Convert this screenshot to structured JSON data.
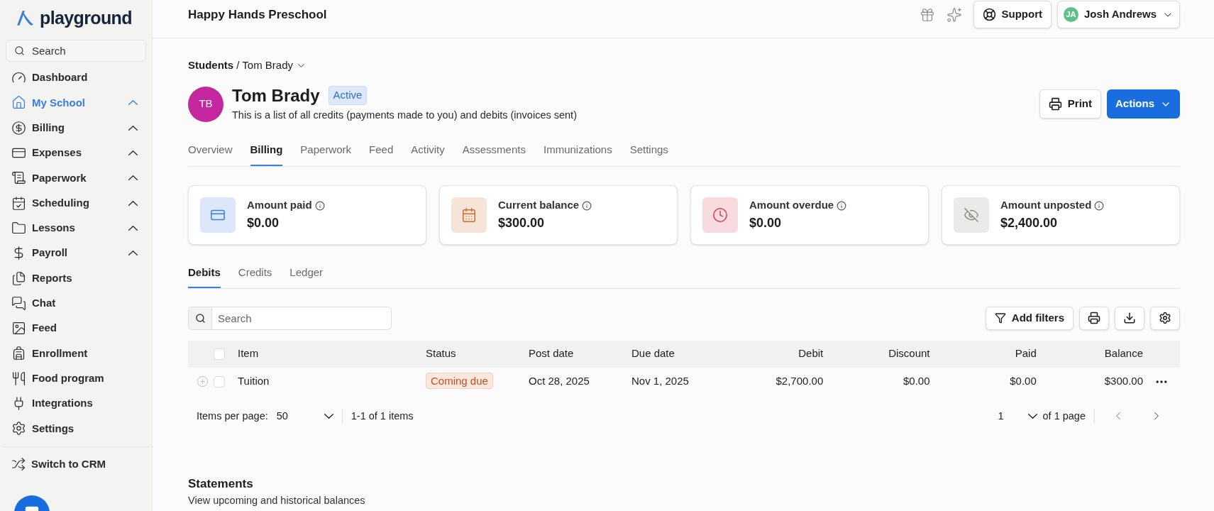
{
  "sidebar": {
    "logo": "playground",
    "search": {
      "placeholder": "Search"
    },
    "items": [
      {
        "label": "Dashboard",
        "kind": "gauge",
        "selected": false,
        "expandable": false
      },
      {
        "label": "My School",
        "kind": "home",
        "selected": true,
        "expandable": true
      },
      {
        "label": "Billing",
        "kind": "dollar-circle",
        "selected": false,
        "expandable": true
      },
      {
        "label": "Expenses",
        "kind": "card",
        "selected": false,
        "expandable": true
      },
      {
        "label": "Paperwork",
        "kind": "scroll",
        "selected": false,
        "expandable": true
      },
      {
        "label": "Scheduling",
        "kind": "calendar-check",
        "selected": false,
        "expandable": true
      },
      {
        "label": "Lessons",
        "kind": "folder",
        "selected": false,
        "expandable": true
      },
      {
        "label": "Payroll",
        "kind": "dollar",
        "selected": false,
        "expandable": true
      },
      {
        "label": "Reports",
        "kind": "files",
        "selected": false,
        "expandable": false
      },
      {
        "label": "Chat",
        "kind": "chat",
        "selected": false,
        "expandable": false
      },
      {
        "label": "Feed",
        "kind": "image",
        "selected": false,
        "expandable": false
      },
      {
        "label": "Enrollment",
        "kind": "backpack",
        "selected": false,
        "expandable": false
      },
      {
        "label": "Food program",
        "kind": "utensils",
        "selected": false,
        "expandable": false
      },
      {
        "label": "Integrations",
        "kind": "plug",
        "selected": false,
        "expandable": false
      },
      {
        "label": "Settings",
        "kind": "settings",
        "selected": false,
        "expandable": false
      }
    ],
    "footer_item": {
      "label": "Switch to CRM"
    }
  },
  "header": {
    "school": "Happy Hands Preschool",
    "support": "Support",
    "user": {
      "initials": "JA",
      "name": "Josh Andrews"
    }
  },
  "breadcrumb": {
    "parent": "Students",
    "separator": "/",
    "current": "Tom Brady"
  },
  "student": {
    "initials": "TB",
    "name": "Tom Brady",
    "status": "Active",
    "description": "This is a list of all credits (payments made to you) and debits (invoices sent)"
  },
  "actions": {
    "print": "Print",
    "actions": "Actions"
  },
  "tabs": [
    {
      "label": "Overview",
      "selected": false
    },
    {
      "label": "Billing",
      "selected": true
    },
    {
      "label": "Paperwork",
      "selected": false
    },
    {
      "label": "Feed",
      "selected": false
    },
    {
      "label": "Activity",
      "selected": false
    },
    {
      "label": "Assessments",
      "selected": false
    },
    {
      "label": "Immunizations",
      "selected": false
    },
    {
      "label": "Settings",
      "selected": false
    }
  ],
  "stats": [
    {
      "label": "Amount paid",
      "value": "$0.00",
      "kind": "card",
      "color": "#3b7ddd"
    },
    {
      "label": "Current balance",
      "value": "$300.00",
      "kind": "calendar",
      "color": "#d2692f"
    },
    {
      "label": "Amount overdue",
      "value": "$0.00",
      "kind": "clock",
      "color": "#d93a4f"
    },
    {
      "label": "Amount unposted",
      "value": "$2,400.00",
      "kind": "eye-off",
      "color": "#8a8a7e"
    }
  ],
  "subtabs": [
    {
      "label": "Debits",
      "selected": true
    },
    {
      "label": "Credits",
      "selected": false
    },
    {
      "label": "Ledger",
      "selected": false
    }
  ],
  "table_search": {
    "placeholder": "Search"
  },
  "add_filters": "Add filters",
  "table": {
    "columns": [
      "Item",
      "Status",
      "Post date",
      "Due date",
      "Debit",
      "Discount",
      "Paid",
      "Balance"
    ],
    "header_checked": false,
    "rows": [
      {
        "checked": false,
        "cells": [
          "Tuition",
          "Coming due",
          "Oct 28, 2025",
          "Nov 1, 2025",
          "$2,700.00",
          "$0.00",
          "$0.00",
          "$300.00"
        ]
      }
    ]
  },
  "pagination": {
    "per_page_label": "Items per page:",
    "per_page": "50",
    "range": "1-1 of 1 items",
    "page": "1",
    "of_pages": "of 1 page"
  },
  "statements": {
    "title": "Statements",
    "subtitle": "View upcoming and historical balances"
  }
}
